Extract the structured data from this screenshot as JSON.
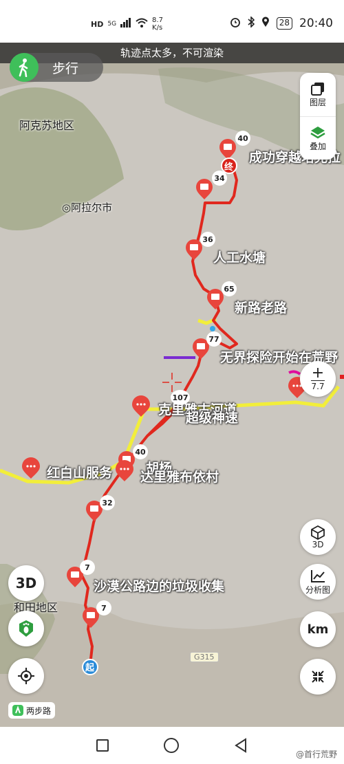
{
  "status_bar": {
    "network": "HD",
    "signal": "5G",
    "speed_value": "8.7",
    "speed_unit": "K/s",
    "battery": "28",
    "time": "20:40"
  },
  "banner": "轨迹点太多，不可渲染",
  "mode": {
    "label": "步行",
    "icon": "walk-icon"
  },
  "side_panel": {
    "layers_label": "图层",
    "overlay_label": "叠加"
  },
  "zoom": {
    "plus": "+",
    "level": "7.7"
  },
  "right_buttons": {
    "view3d_label": "3D",
    "analysis_label": "分析图",
    "unit_label": "km"
  },
  "left_buttons": {
    "mode3d_label": "3D"
  },
  "tag": {
    "label": "两步路"
  },
  "places": {
    "aksu": "阿克苏地区",
    "alar": "◎阿拉尔市",
    "hotan": "和田地区"
  },
  "road_sign": "G315",
  "waypoint_labels": {
    "success": "成功穿越塔克拉",
    "water": "人工水塘",
    "newroad": "新路老路",
    "adventure": "无界探险开始在荒野",
    "river": "克里雅古河道",
    "super": "超级神速",
    "hongbai": "红白山服务",
    "huyang": "胡杨",
    "village": "达里雅布依村",
    "trash": "沙漠公路边的垃圾收集"
  },
  "counts": {
    "c40a": "40",
    "c34": "34",
    "c36": "36",
    "c65": "65",
    "c77": "77",
    "c107": "107",
    "c40b": "40",
    "c32": "32",
    "c7a": "7",
    "c7b": "7"
  },
  "markers": {
    "start": "起",
    "end": "终"
  },
  "watermark": "@首行荒野",
  "colors": {
    "track": "#e0281e",
    "road": "#f2ee3a",
    "marker": "#e8453c",
    "accent": "#3fbf5a"
  }
}
